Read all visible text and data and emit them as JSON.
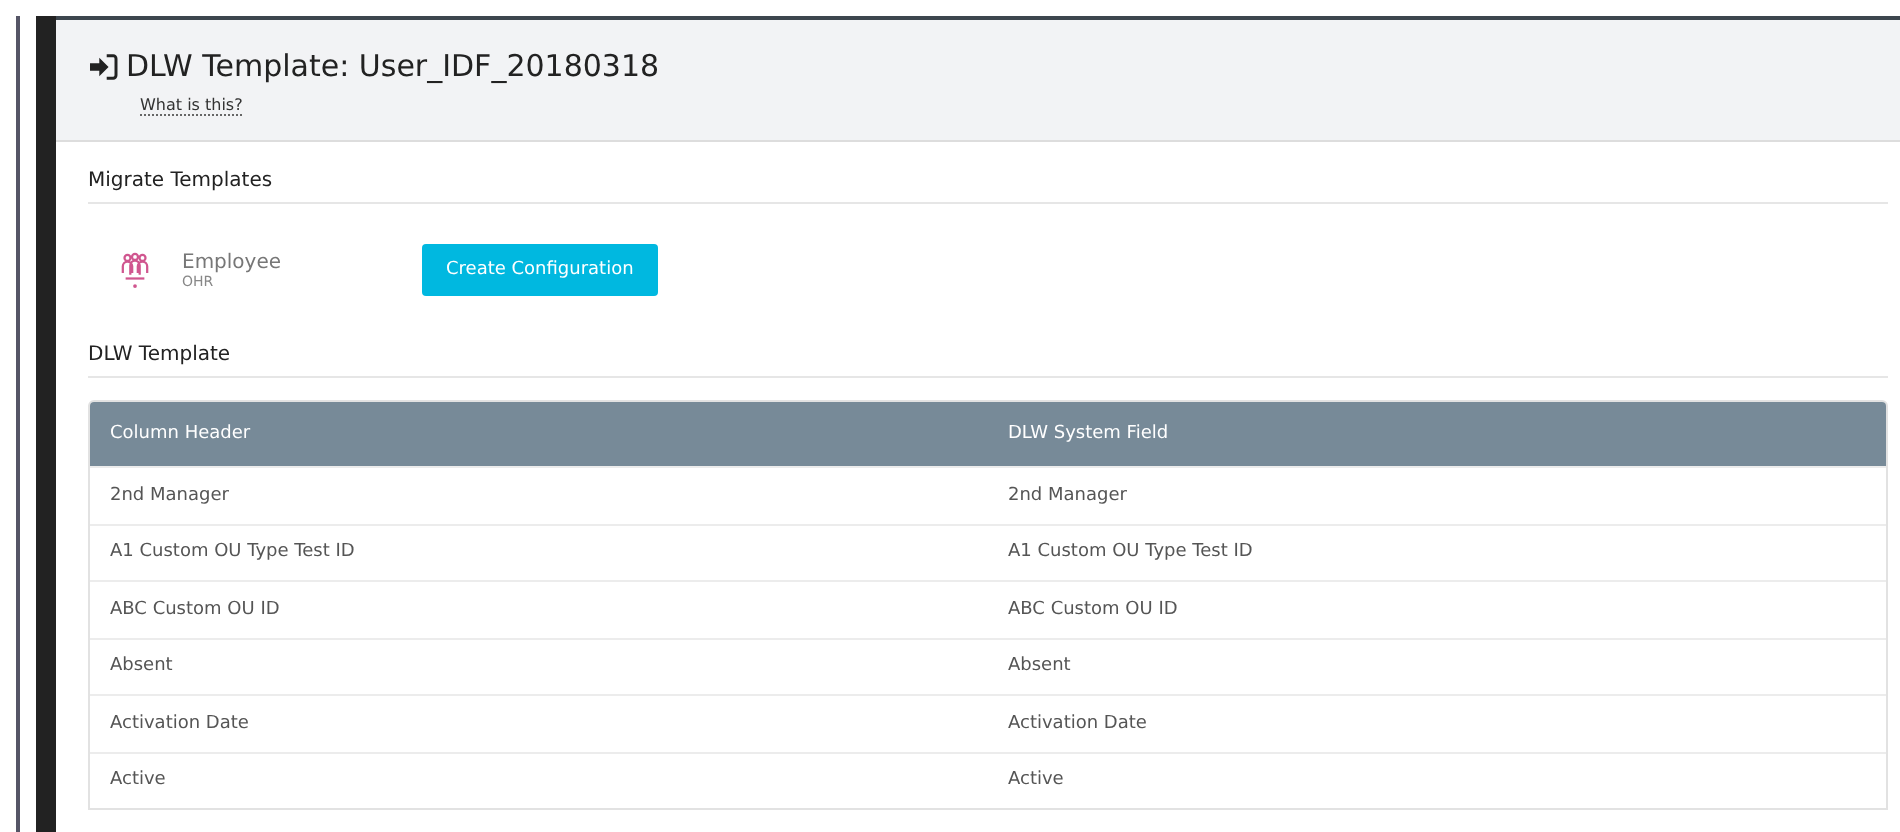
{
  "header": {
    "title": "DLW Template: User_IDF_20180318",
    "help_link": "What is this?"
  },
  "migrate": {
    "title": "Migrate Templates",
    "template": {
      "name": "Employee",
      "source": "OHR"
    },
    "button": "Create Configuration"
  },
  "table": {
    "title": "DLW Template",
    "columns": [
      "Column Header",
      "DLW System Field"
    ],
    "rows": [
      [
        "2nd Manager",
        "2nd Manager"
      ],
      [
        "A1 Custom OU Type Test ID",
        "A1 Custom OU Type Test ID"
      ],
      [
        "ABC Custom OU ID",
        "ABC Custom OU ID"
      ],
      [
        "Absent",
        "Absent"
      ],
      [
        "Activation Date",
        "Activation Date"
      ],
      [
        "Active",
        "Active"
      ]
    ]
  }
}
